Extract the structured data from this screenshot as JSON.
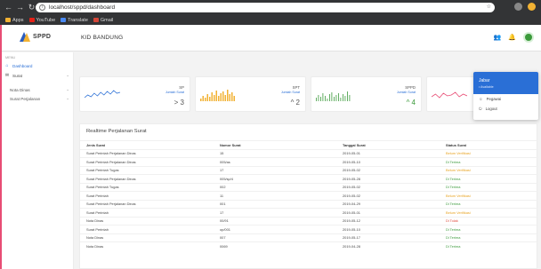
{
  "browser": {
    "url": "localhost/sppd/dashboard",
    "bookmarks": [
      {
        "label": "Apps",
        "color": "#f2b233"
      },
      {
        "label": "YouTube",
        "color": "#e62117"
      },
      {
        "label": "Translate",
        "color": "#4a8af4"
      },
      {
        "label": "Gmail",
        "color": "#d44638"
      }
    ]
  },
  "app": {
    "logo_text": "SPPD",
    "page_heading": "KID BANDUNG"
  },
  "sidebar": {
    "section_label": "MENU",
    "items": [
      {
        "label": "Dashboard",
        "icon": "home-icon",
        "glyph": "⌂",
        "active": true
      },
      {
        "label": "Surat",
        "icon": "envelope-icon",
        "glyph": "✉",
        "active": false
      },
      {
        "label": "Nota Dinas",
        "sub": true
      },
      {
        "label": "Surat Perjalanan",
        "sub": true
      }
    ]
  },
  "cards": [
    {
      "title": "SP",
      "sub": "Jumlah Surat",
      "value": "> 3",
      "value_color": "normal",
      "chart": "line"
    },
    {
      "title": "SPT",
      "sub": "Jumlah Surat",
      "value": "^ 2",
      "value_color": "normal",
      "chart": "bar"
    },
    {
      "title": "SPPD",
      "sub": "Jumlah Surat",
      "value": "^ 4",
      "value_color": "green",
      "chart": "bar-thin"
    },
    {
      "title": "",
      "sub": "",
      "value": "",
      "value_color": "normal",
      "chart": "line-red"
    }
  ],
  "dropdown": {
    "name": "Jabar",
    "status": "• Available",
    "items": [
      {
        "label": "Pegawai",
        "icon": "user-icon",
        "glyph": "☺"
      },
      {
        "label": "Logout",
        "icon": "logout-icon",
        "glyph": "⏻"
      }
    ]
  },
  "table": {
    "title": "Realtime Perjalanan Surat",
    "headers": [
      "Jenis Surat",
      "Nomor Surat",
      "Tanggal Surat",
      "Status Surat"
    ],
    "rows": [
      [
        "Surat Perintah Perjalanan Dinas",
        "15",
        "2019-05-01",
        "Belum Verifikasi",
        "wait"
      ],
      [
        "Surat Perintah Perjalanan Dinas",
        "005/as",
        "2019-05-10",
        "Di Terima",
        "ok"
      ],
      [
        "Surat Perintah Tugas",
        "17",
        "2019-05-02",
        "Belum Verifikasi",
        "wait"
      ],
      [
        "Surat Perintah Perjalanan Dinas",
        "005/sp/4",
        "2019-05-28",
        "Di Terima",
        "ok"
      ],
      [
        "Surat Perintah Tugas",
        "002",
        "2019-05-02",
        "Di Terima",
        "ok"
      ],
      [
        "Surat Perintah",
        "11",
        "2019-05-02",
        "Belum Verifikasi",
        "wait"
      ],
      [
        "Surat Perintah Perjalanan Dinas",
        "001",
        "2019-04-29",
        "Di Terima",
        "ok"
      ],
      [
        "Surat Perintah",
        "17",
        "2019-05-01",
        "Belum Verifikasi",
        "wait"
      ],
      [
        "Nota Dinas",
        "00/91",
        "2019-05-12",
        "Di Tolak",
        "no"
      ],
      [
        "Surat Perintah",
        "op/001",
        "2019-05-10",
        "Di Terima",
        "ok"
      ],
      [
        "Nota Dinas",
        "007",
        "2019-05-17",
        "Di Terima",
        "ok"
      ],
      [
        "Nota Dinas",
        "0069",
        "2019-04-28",
        "Di Terima",
        "ok"
      ]
    ]
  },
  "colors": {
    "accent": "#2a6fd6",
    "ok": "#3b9a3b",
    "wait": "#e8a321",
    "reject": "#e04b3d",
    "bar_chart": "#f2b233",
    "line_chart": "#2a6fd6",
    "bar_thin_chart": "#3b9a3b",
    "line_red_chart": "#e84c74"
  }
}
